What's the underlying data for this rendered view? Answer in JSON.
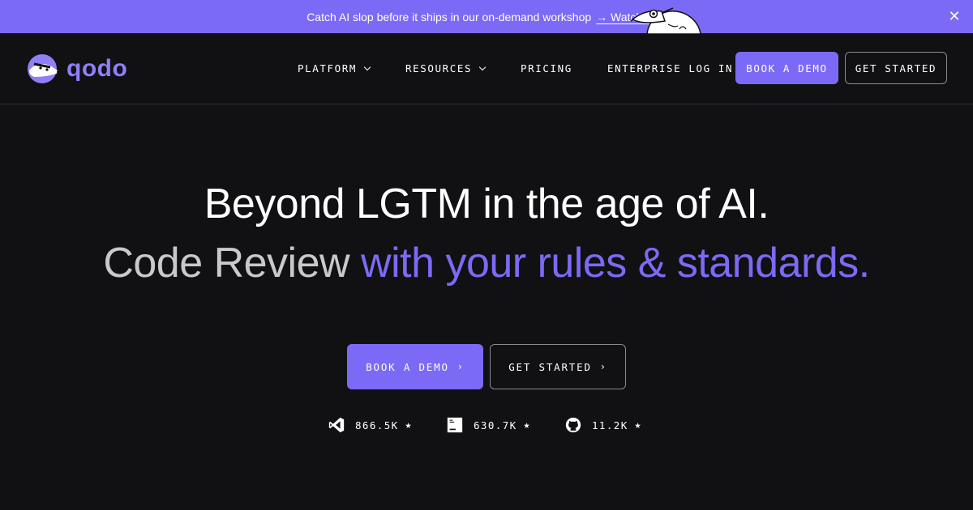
{
  "announcement": {
    "text": "Catch AI slop before it ships in our on-demand workshop",
    "link": "→ Watch now",
    "close_icon": "close-icon"
  },
  "brand": {
    "name": "qodo",
    "accent": "#7b6af5",
    "logo_icon": "qodo-badger-logo"
  },
  "nav": {
    "items": [
      {
        "label": "PLATFORM",
        "dropdown": true
      },
      {
        "label": "RESOURCES",
        "dropdown": true
      },
      {
        "label": "PRICING",
        "dropdown": false
      },
      {
        "label": "ENTERPRISE LOG IN",
        "dropdown": false
      }
    ],
    "book_demo": "BOOK A DEMO",
    "get_started": "GET STARTED"
  },
  "hero": {
    "headline": "Beyond LGTM in the age of AI.",
    "sub_grey": "Code Review ",
    "sub_purple": "with your rules & standards.",
    "book_demo": "BOOK A DEMO",
    "get_started": "GET STARTED"
  },
  "stats": [
    {
      "icon": "vscode-icon",
      "value": "866.5K"
    },
    {
      "icon": "jetbrains-icon",
      "value": "630.7K"
    },
    {
      "icon": "github-icon",
      "value": "11.2K"
    }
  ]
}
